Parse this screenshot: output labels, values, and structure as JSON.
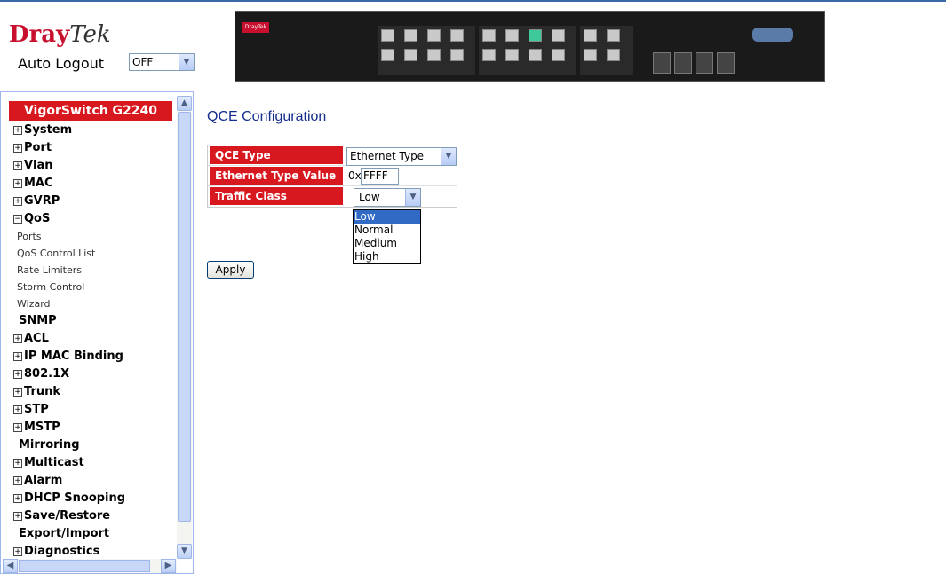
{
  "header": {
    "logo_dray": "Dray",
    "logo_tek": "Tek",
    "auto_logout_label": "Auto Logout",
    "auto_logout_value": "OFF"
  },
  "sidebar": {
    "title": "VigorSwitch G2240",
    "items": [
      {
        "label": "System",
        "expander": "+"
      },
      {
        "label": "Port",
        "expander": "+"
      },
      {
        "label": "Vlan",
        "expander": "+"
      },
      {
        "label": "MAC",
        "expander": "+"
      },
      {
        "label": "GVRP",
        "expander": "+"
      },
      {
        "label": "QoS",
        "expander": "−"
      }
    ],
    "qos_subitems": [
      "Ports",
      "QoS Control List",
      "Rate Limiters",
      "Storm Control",
      "Wizard"
    ],
    "items_after": [
      {
        "label": "SNMP",
        "expander": ""
      },
      {
        "label": "ACL",
        "expander": "+"
      },
      {
        "label": "IP MAC Binding",
        "expander": "+"
      },
      {
        "label": "802.1X",
        "expander": "+"
      },
      {
        "label": "Trunk",
        "expander": "+"
      },
      {
        "label": "STP",
        "expander": "+"
      },
      {
        "label": "MSTP",
        "expander": "+"
      },
      {
        "label": "Mirroring",
        "expander": ""
      },
      {
        "label": "Multicast",
        "expander": "+"
      },
      {
        "label": "Alarm",
        "expander": "+"
      },
      {
        "label": "DHCP Snooping",
        "expander": "+"
      },
      {
        "label": "Save/Restore",
        "expander": "+"
      },
      {
        "label": "Export/Import",
        "expander": ""
      },
      {
        "label": "Diagnostics",
        "expander": "+"
      }
    ]
  },
  "main": {
    "title": "QCE Configuration",
    "qce_type_label": "QCE Type",
    "qce_type_value": "Ethernet Type",
    "ethertype_label": "Ethernet Type Value",
    "ethertype_prefix": "0x",
    "ethertype_value": "FFFF",
    "traffic_label": "Traffic Class",
    "traffic_value": "Low",
    "traffic_options": [
      "Low",
      "Normal",
      "Medium",
      "High"
    ],
    "traffic_selected": "Low",
    "apply_label": "Apply"
  },
  "colors": {
    "accent_red": "#d7181f",
    "title_blue": "#142c8c",
    "selection_blue": "#316ac5"
  }
}
